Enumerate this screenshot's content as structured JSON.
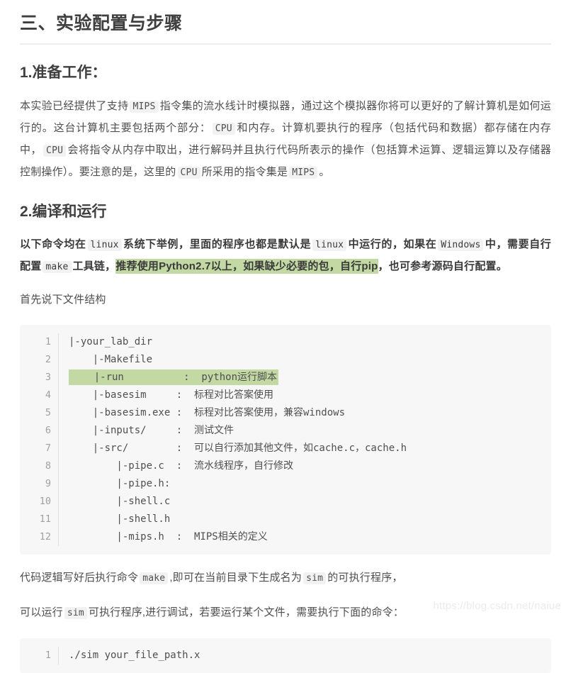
{
  "doc": {
    "title": "三、实验配置与步骤",
    "watermark": "https://blog.csdn.net/naiue"
  },
  "section1": {
    "heading": "1.准备工作：",
    "paragraph": {
      "p1": "本实验已经提供了支持",
      "c1": "MIPS",
      "p2": "指令集的流水线计时模拟器，通过这个模拟器你将可以更好的了解计算机是如何运行的。这台计算机主要包括两个部分：",
      "c2": "CPU",
      "p3": "和内存。计算机要执行的程序（包括代码和数据）都存储在内存中，",
      "c3": "CPU",
      "p4": "会将指令从内存中取出，进行解码并且执行代码所表示的操作（包括算术运算、逻辑运算以及存储器控制操作）。要注意的是，这里的",
      "c4": "CPU",
      "p5": "所采用的指令集是",
      "c5": "MIPS",
      "p6": "。"
    }
  },
  "section2": {
    "heading": "2.编译和运行",
    "paragraph": {
      "p1": "以下命令均在",
      "c1": "linux",
      "p2": "系统下举例，里面的程序也都是默认是",
      "c2": "linux",
      "p3": "中运行的，如果在",
      "c3": "Windows",
      "p4": "中，需要自行配置",
      "c4": "make",
      "p5": "工具链，",
      "hl1": "推荐使用Python2.7以上，如果缺少必要的包，自行pip",
      "p6": "，也可参考源码自行配置。"
    },
    "intro": "首先说下文件结构"
  },
  "code_block_1": {
    "line_numbers": [
      "1",
      "2",
      "3",
      "4",
      "5",
      "6",
      "7",
      "8",
      "9",
      "10",
      "11",
      "12"
    ],
    "lines": [
      {
        "text": "|-your_lab_dir",
        "highlight": false
      },
      {
        "text": "    |-Makefile",
        "highlight": false
      },
      {
        "text": "    |-run          :  python运行脚本",
        "highlight": true
      },
      {
        "text": "    |-basesim     :  标程对比答案使用",
        "highlight": false
      },
      {
        "text": "    |-basesim.exe :  标程对比答案使用，兼容windows",
        "highlight": false
      },
      {
        "text": "    |-inputs/     :  测试文件",
        "highlight": false
      },
      {
        "text": "    |-src/        :  可以自行添加其他文件，如cache.c，cache.h",
        "highlight": false
      },
      {
        "text": "        |-pipe.c  :  流水线程序，自行修改",
        "highlight": false
      },
      {
        "text": "        |-pipe.h:",
        "highlight": false
      },
      {
        "text": "        |-shell.c",
        "highlight": false
      },
      {
        "text": "        |-shell.h",
        "highlight": false
      },
      {
        "text": "        |-mips.h  :  MIPS相关的定义",
        "highlight": false
      }
    ]
  },
  "after_code": {
    "p1": {
      "a": "代码逻辑写好后执行命令",
      "c1": "make",
      "b": ",即可在当前目录下生成名为",
      "c2": "sim",
      "c": "的可执行程序，"
    },
    "p2": {
      "a": "可以运行",
      "c1": "sim",
      "b": "可执行程序,进行调试，若要运行某个文件，需要执行下面的命令："
    }
  },
  "code_block_2": {
    "line_numbers": [
      "1"
    ],
    "lines": [
      {
        "text": "./sim your_file_path.x",
        "highlight": false
      }
    ]
  }
}
